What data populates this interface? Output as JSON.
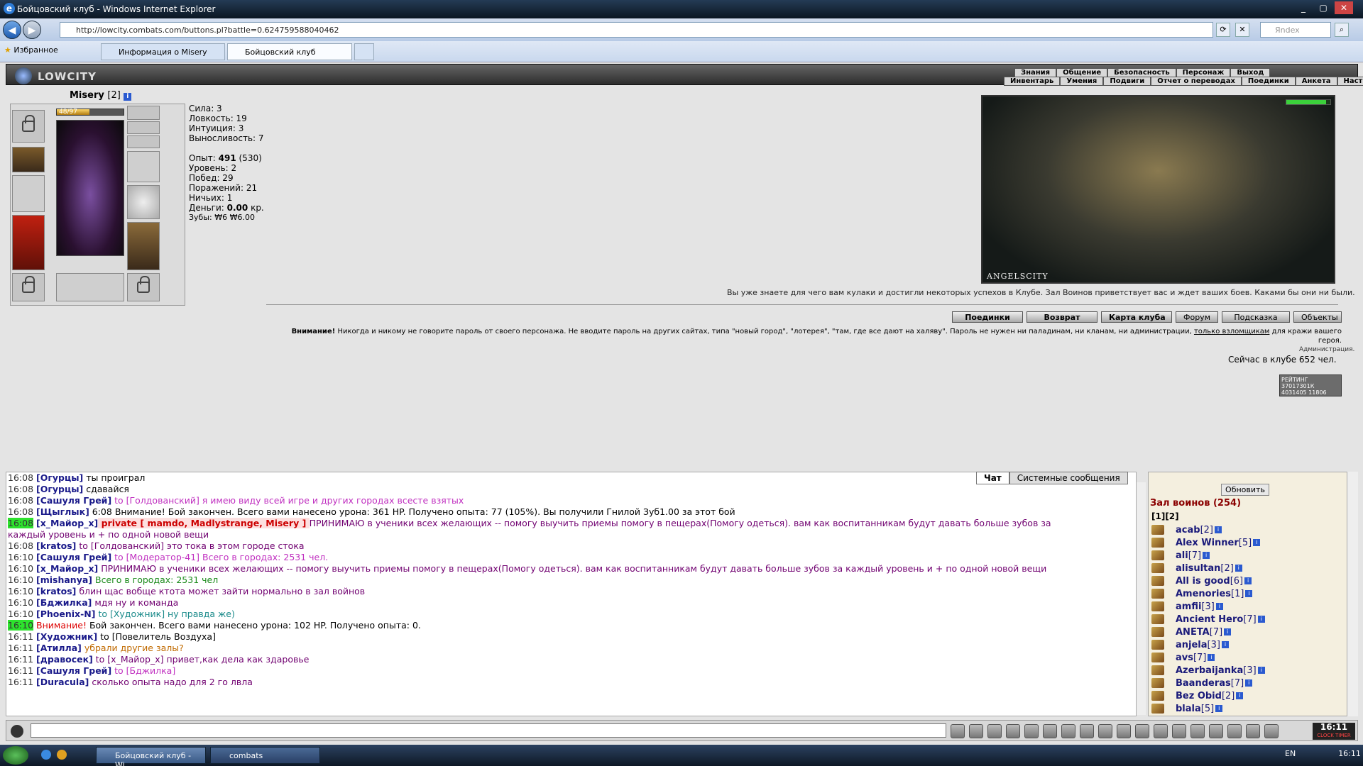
{
  "window": {
    "title": "Бойцовский клуб - Windows Internet Explorer"
  },
  "browser": {
    "address": "http://lowcity.combats.com/buttons.pl?battle=0.624759588040462",
    "search_placeholder": "Яndex",
    "favorites": "Избранное",
    "tabs": [
      "Информация о Misery",
      "Бойцовский клуб"
    ]
  },
  "game": {
    "logo": "LOWCITY",
    "menu_top": [
      "Знания",
      "Общение",
      "Безопасность",
      "Персонаж",
      "Выход"
    ],
    "menu_bottom": [
      "Инвентарь",
      "Умения",
      "Подвиги",
      "Отчет о переводах",
      "Поединки",
      "Анкета",
      "Настройки"
    ],
    "char": {
      "name": "Misery",
      "level": "[2]",
      "hp": "48/97",
      "hp_fraction": 0.49
    },
    "stats": {
      "str": "Сила: 3",
      "agi": "Ловкость: 19",
      "int": "Интуиция: 3",
      "end": "Выносливость: 7",
      "exp_label": "Опыт: ",
      "exp": "491",
      "exp_next": " (530)",
      "level": "Уровень: 2",
      "wins": "Побед: 29",
      "losses": "Поражений: 21",
      "draws": "Ничьих: 1",
      "money_label": "Деньги: ",
      "money": "0.00",
      "money_unit": " кр.",
      "teeth": "Зубы: ₩6 ₩6.00"
    },
    "room_caption": "ANGELSCITY",
    "greeting": "Вы уже знаете для чего вам кулаки и достигли некоторых успехов в Клубе. Зал Воинов приветствует вас и ждет ваших боев. Каками бы они ни были.",
    "actions": [
      "Поединки",
      "Возврат",
      "Карта клуба",
      "Форум",
      "Подсказка",
      "Объекты"
    ],
    "warning_bold": "Внимание!",
    "warning": " Никогда и никому не говорите пароль от своего персонажа. Не вводите пароль на других сайтах, типа \"новый город\", \"лотерея\", \"там, где все дают на халяву\". Пароль не нужен ни паладинам, ни кланам, ни администрации, ",
    "warning_link": "только взломщикам",
    "warning_end": " для кражи вашего героя.",
    "admin": "Администрация.",
    "online": "Сейчас в клубе 652 чел.",
    "counter": "РЕЙТИНГ 37017301К 4031405 11806"
  },
  "chat": {
    "tabs": [
      "Чат",
      "Системные сообщения"
    ],
    "lines": [
      {
        "t": "16:08",
        "n": "[Огурцы]",
        "m": " ты проиграл",
        "c": ""
      },
      {
        "t": "16:08",
        "n": "[Огурцы]",
        "m": " сдавайся",
        "c": ""
      },
      {
        "t": "16:08",
        "n": "[Сашуля Грей]",
        "m": " to [Голдованский] я имею виду всей игре и других городах всесте взятых",
        "c": "pink"
      },
      {
        "t": "16:08",
        "n": "[Щыглык]",
        "m": " 6:08 Внимание! Бой закончен. Всего вами нанесено урона: 361 HP. Получено опыта: 77 (105%). Вы получили Гнилой Зуб1.00 за этот бой",
        "c": ""
      },
      {
        "t": "16:08",
        "n": "[x_Майор_x]",
        "p": " private [ mamdo, Madlystrange, Misery ] ",
        "m": "ПРИНИМАЮ в ученики всех желающих -- помогу выучить приемы помогу в пещерах(Помогу одеться). вам как воспитанникам будут давать больше зубов за",
        "c": "purple",
        "hl": true
      },
      {
        "t": "",
        "n": "",
        "m": "каждый уровень и + по одной новой вещи",
        "c": "purple"
      },
      {
        "t": "16:08",
        "n": "[kratos]",
        "m": " to [Голдованский] это тока в этом городе стока",
        "c": "purple"
      },
      {
        "t": "16:10",
        "n": "[Сашуля Грей]",
        "m": " to [Модератор-41] Всего в городах: 2531 чел.",
        "c": "pink"
      },
      {
        "t": "16:10",
        "n": "[x_Майор_x]",
        "m": " ПРИНИМАЮ в ученики всех желающих -- помогу выучить приемы помогу в пещерах(Помогу одеться). вам как воспитанникам будут давать больше зубов за каждый уровень и + по одной новой вещи",
        "c": "purple"
      },
      {
        "t": "16:10",
        "n": "[mishanya]",
        "m": " Всего в городах: 2531 чел",
        "c": "green"
      },
      {
        "t": "16:10",
        "n": "[kratos]",
        "m": " блин щас вобще ктота может зайти нормально в зал войнов",
        "c": "purple"
      },
      {
        "t": "16:10",
        "n": "[Бджилка]",
        "m": " мдя ну и команда",
        "c": "purple"
      },
      {
        "t": "16:10",
        "n": "[Phoenix-N]",
        "m": " to [Художник] ну правда же)",
        "c": "teal"
      },
      {
        "t": "16:10",
        "n": "",
        "r": "Внимание!",
        "m": " Бой закончен. Всего вами нанесено урона: 102 HP. Получено опыта: 0.",
        "c": "",
        "hl": true
      },
      {
        "t": "16:11",
        "n": "[Художник]",
        "m": " to [Повелитель Воздуха]",
        "c": ""
      },
      {
        "t": "16:11",
        "n": "[Атилла]",
        "m": " убрали другие залы?",
        "c": "orange"
      },
      {
        "t": "16:11",
        "n": "[дравосек]",
        "m": " to [x_Майор_x] привет,как дела как здаровье",
        "c": "purple"
      },
      {
        "t": "16:11",
        "n": "[Сашуля Грей]",
        "m": " to [Бджилка]",
        "c": "pink"
      },
      {
        "t": "16:11",
        "n": "[Duracula]",
        "m": " сколько опыта надо для 2 го лвла",
        "c": "purple"
      }
    ]
  },
  "userlist": {
    "refresh": "Обновить",
    "title": "Зал воинов (254)",
    "pages": "[1][2]",
    "users": [
      {
        "name": "acab",
        "lvl": "[2]"
      },
      {
        "name": "Alex Winner",
        "lvl": "[5]"
      },
      {
        "name": "ali",
        "lvl": "[7]"
      },
      {
        "name": "alisultan",
        "lvl": "[2]"
      },
      {
        "name": "All is good",
        "lvl": "[6]"
      },
      {
        "name": "Amenories",
        "lvl": "[1]"
      },
      {
        "name": "amfii",
        "lvl": "[3]"
      },
      {
        "name": "Ancient Hero",
        "lvl": "[7]"
      },
      {
        "name": "ANETA",
        "lvl": "[7]"
      },
      {
        "name": "anjela",
        "lvl": "[3]"
      },
      {
        "name": "avs",
        "lvl": "[7]"
      },
      {
        "name": "Azerbaijanka",
        "lvl": "[3]"
      },
      {
        "name": "Baanderas",
        "lvl": "[7]"
      },
      {
        "name": "Bez Obid",
        "lvl": "[2]"
      },
      {
        "name": "blala",
        "lvl": "[5]"
      }
    ]
  },
  "toolbar": {
    "clock": "16:11",
    "clock_label": "CLOCK TIMER"
  },
  "taskbar": {
    "tasks": [
      "Бойцовский клуб - Wi...",
      "combats"
    ],
    "lang": "EN",
    "time": "16:11"
  }
}
